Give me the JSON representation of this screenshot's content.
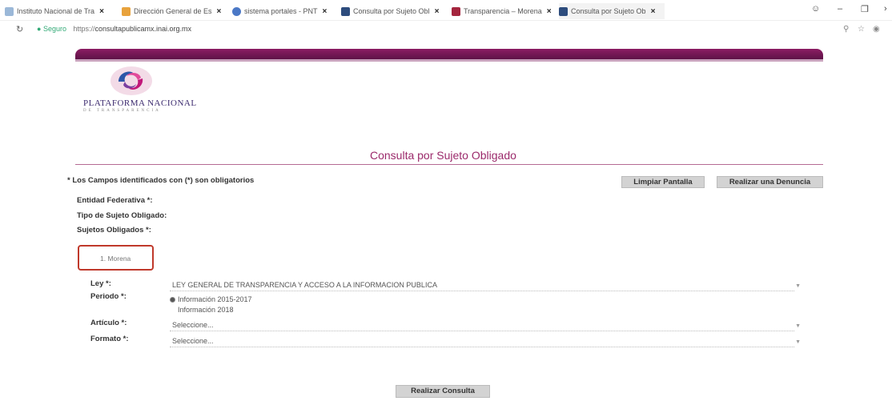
{
  "browser": {
    "tabs": [
      {
        "label": "Instituto Nacional de Tra",
        "color": "#9bb8d8"
      },
      {
        "label": "Dirección General de Es",
        "color": "#e8a23c"
      },
      {
        "label": "sistema portales - PNT",
        "color": "#4b78c6"
      },
      {
        "label": "Consulta por Sujeto Obl",
        "color": "#2d4c7d"
      },
      {
        "label": "Transparencia – Morena",
        "color": "#a4253e"
      },
      {
        "label": "Consulta por Sujeto Ob",
        "color": "#2d4c7d"
      }
    ],
    "secure_label": "Seguro",
    "url_scheme": "https://",
    "url_host": "consultapublicamx.inai.org.mx"
  },
  "header": {
    "logo_title": "Plataforma Nacional",
    "logo_subtitle": "de Transparencia"
  },
  "page": {
    "title": "Consulta por Sujeto Obligado",
    "required_note": "* Los Campos identificados con (*) son obligatorios",
    "clear_button": "Limpiar Pantalla",
    "report_button": "Realizar una Denuncia"
  },
  "form": {
    "entity_label": "Entidad Federativa *:",
    "subject_type_label": "Tipo de Sujeto Obligado:",
    "subjects_label": "Sujetos Obligados *:",
    "selected_subject": "1. Morena",
    "law_label": "Ley *:",
    "law_value": "LEY GENERAL DE TRANSPARENCIA Y ACCESO A LA INFORMACION PUBLICA",
    "period_label": "Periodo *:",
    "period_options": [
      "Información 2015-2017",
      "Información 2018"
    ],
    "period_selected": "Información 2015-2017",
    "article_label": "Artículo *:",
    "article_value": "Seleccione...",
    "format_label": "Formato *:",
    "format_value": "Seleccione...",
    "submit_button": "Realizar Consulta"
  }
}
